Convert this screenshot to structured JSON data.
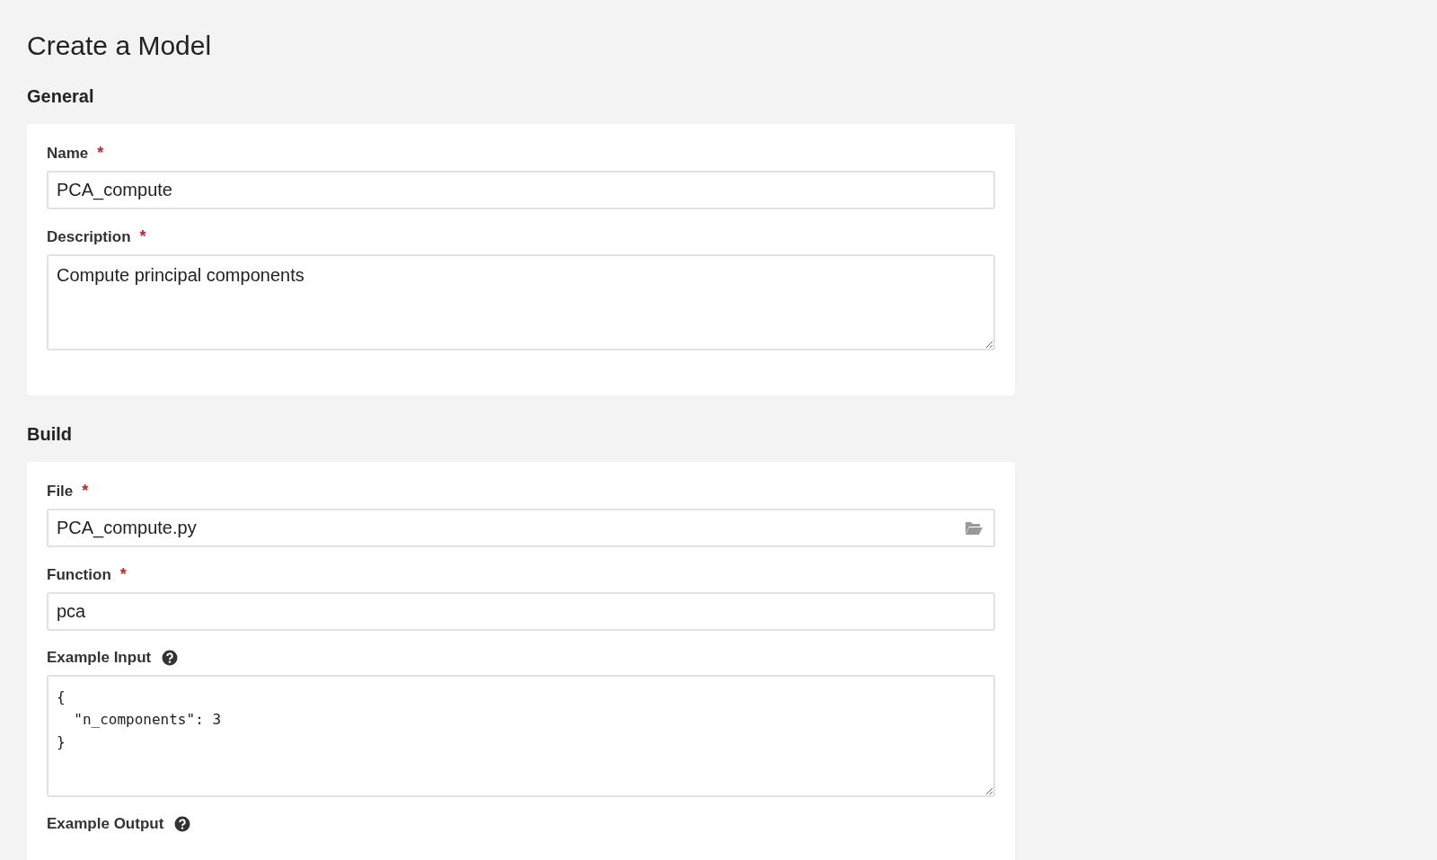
{
  "title": "Create a Model",
  "sections": [
    {
      "heading": "General",
      "fields": [
        {
          "kind": "text",
          "label": "Name",
          "required_mark": "*",
          "help": false,
          "value": "PCA_compute"
        },
        {
          "kind": "textarea",
          "label": "Description",
          "required_mark": "*",
          "help": false,
          "value": "Compute principal components"
        }
      ]
    },
    {
      "heading": "Build",
      "fields": [
        {
          "kind": "file",
          "label": "File",
          "required_mark": "*",
          "help": false,
          "value": "PCA_compute.py"
        },
        {
          "kind": "text",
          "label": "Function",
          "required_mark": "*",
          "help": false,
          "value": "pca"
        },
        {
          "kind": "code",
          "label": "Example Input",
          "help": true,
          "value": "{\n  \"n_components\": 3\n}"
        },
        {
          "kind": "label",
          "label": "Example Output",
          "help": true
        }
      ]
    }
  ]
}
